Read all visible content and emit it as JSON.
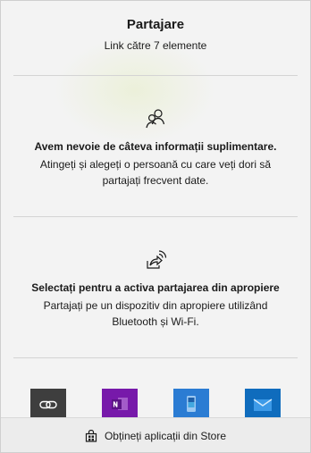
{
  "header": {
    "title": "Partajare",
    "subtitle": "Link către 7 elemente"
  },
  "people_section": {
    "icon": "people-icon",
    "title": "Avem nevoie de câteva informații suplimentare.",
    "body": "Atingeți și alegeți o persoană cu care veți dori să partajați frecvent date."
  },
  "nearby_section": {
    "icon": "nearby-share-icon",
    "title": "Selectați pentru a activa partajarea din apropiere",
    "body": "Partajați pe un dispozitiv din apropiere utilizând Bluetooth și Wi-Fi."
  },
  "apps": [
    {
      "icon": "copy-link-icon",
      "color": "#3e3e3e"
    },
    {
      "icon": "onenote-icon",
      "color": "#7719aa"
    },
    {
      "icon": "phone-app-icon",
      "color": "#2b7cd3"
    },
    {
      "icon": "mail-icon",
      "color": "#0f6cbd"
    }
  ],
  "footer": {
    "icon": "store-bag-icon",
    "label": "Obțineți aplicații din Store"
  }
}
